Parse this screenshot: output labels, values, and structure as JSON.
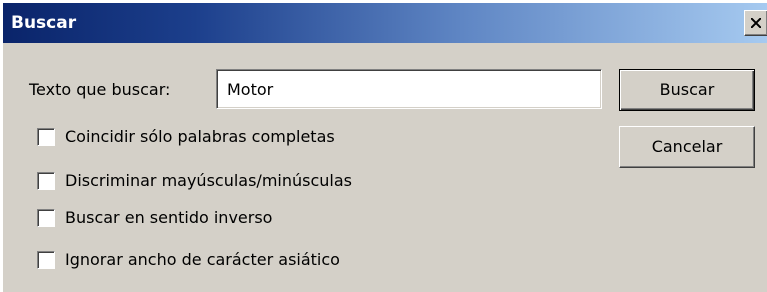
{
  "window": {
    "title": "Buscar",
    "close_glyph": "X",
    "titlebar_colors": [
      "#0a246a",
      "#a6caf0"
    ],
    "face_color": "#d4d0c8"
  },
  "search": {
    "label": "Texto que buscar:",
    "value": "Motor"
  },
  "options": [
    {
      "label": "Coincidir sólo palabras completas",
      "checked": false
    },
    {
      "label": "Discriminar mayúsculas/minúsculas",
      "checked": false
    },
    {
      "label": "Buscar en sentido inverso",
      "checked": false
    },
    {
      "label": "Ignorar ancho de carácter asiático",
      "checked": false
    }
  ],
  "buttons": {
    "find": "Buscar",
    "cancel": "Cancelar"
  },
  "icons": {
    "close": "close-icon"
  }
}
